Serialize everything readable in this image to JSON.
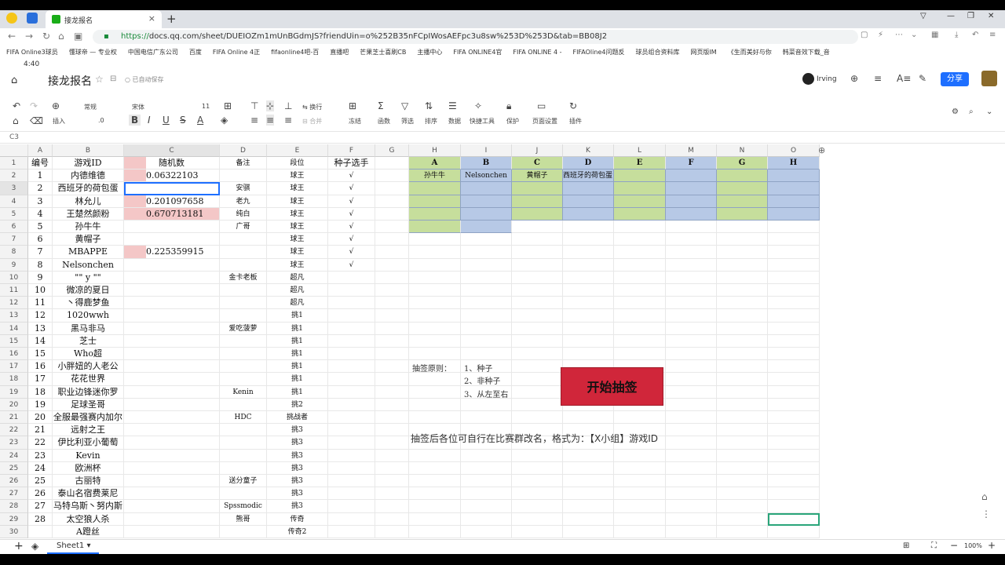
{
  "browser": {
    "tab_title": "接龙报名",
    "url_scheme": "https://",
    "url_rest": "docs.qq.com/sheet/DUEIOZm1mUnBGdmJS?friendUin=o%252B35nFCpIWosAEFpc3u8sw%253D%253D&tab=BB08J2",
    "bookmarks": [
      "FIFA Online3球员",
      "懂球帝 — 专业权",
      "中国电信广东公司",
      "百度",
      "FIFA Online 4正",
      "fifaonline4吧-百",
      "直播吧",
      "芒果芝士喜刷CB",
      "主播中心",
      "FIFA ONLINE4官",
      "FIFA ONLINE 4 -",
      "FIFAOline4问题反",
      "球员组合资料库",
      "网页版IM",
      "《生而美好与你",
      "韩菜音效下载_音"
    ]
  },
  "header": {
    "title": "接龙报名",
    "autosave": "已自动保存",
    "user": "Irving",
    "share": "分享"
  },
  "toolbar": {
    "font_style": "常规",
    "font": "宋体",
    "size": "11",
    "insert": "插入",
    "wrap": "换行",
    "merge": "合并",
    "freeze": "冻结",
    "func": "函数",
    "filter": "筛选",
    "sort": "排序",
    "data": "数据",
    "quick": "快捷工具",
    "protect": "保护",
    "page": "页面设置",
    "plugin": "插件"
  },
  "formula": {
    "cell_ref": "C3"
  },
  "columns": [
    "A",
    "B",
    "C",
    "D",
    "E",
    "F",
    "G",
    "H",
    "I",
    "J",
    "K",
    "L",
    "M",
    "N",
    "O"
  ],
  "rows_left": [
    [
      "编号",
      "游戏ID",
      "随机数",
      "备注",
      "段位",
      "种子选手"
    ],
    [
      "1",
      "内德维德",
      "0.06322103",
      "",
      "球王",
      "√"
    ],
    [
      "2",
      "西班牙的荷包蛋",
      "",
      "安骐",
      "球王",
      "√"
    ],
    [
      "3",
      "林允儿",
      "0.201097658",
      "老九",
      "球王",
      "√"
    ],
    [
      "4",
      "王楚然颜粉",
      "0.670713181",
      "纯白",
      "球王",
      "√"
    ],
    [
      "5",
      "孙牛牛",
      "",
      "广哥",
      "球王",
      "√"
    ],
    [
      "6",
      "黄帽子",
      "",
      "",
      "球王",
      "√"
    ],
    [
      "7",
      "MBAPPE",
      "0.225359915",
      "",
      "球王",
      "√"
    ],
    [
      "8",
      "Nelsonchen",
      "",
      "",
      "球王",
      "√"
    ],
    [
      "9",
      "\"\" y \"\"",
      "",
      "金卡老板",
      "超凡",
      ""
    ],
    [
      "10",
      "微凉的夏日",
      "",
      "",
      "超凡",
      ""
    ],
    [
      "11",
      "丶得鹿梦鱼",
      "",
      "",
      "超凡",
      ""
    ],
    [
      "12",
      "1020wwh",
      "",
      "",
      "挑1",
      ""
    ],
    [
      "13",
      "黑马非马",
      "",
      "爱吃菠萝",
      "挑1",
      ""
    ],
    [
      "14",
      "芝士",
      "",
      "",
      "挑1",
      ""
    ],
    [
      "15",
      "Who超",
      "",
      "",
      "挑1",
      ""
    ],
    [
      "16",
      "小胖妞的人老公",
      "",
      "",
      "挑1",
      ""
    ],
    [
      "17",
      "花花世界",
      "",
      "",
      "挑1",
      ""
    ],
    [
      "18",
      "职业边锋迷你罗",
      "",
      "Kenin",
      "挑1",
      ""
    ],
    [
      "19",
      "足球圣哥",
      "",
      "",
      "挑2",
      ""
    ],
    [
      "20",
      "全服最强赛内加尔",
      "",
      "HDC",
      "挑战者",
      ""
    ],
    [
      "21",
      "远射之王",
      "",
      "",
      "挑3",
      ""
    ],
    [
      "22",
      "伊比利亚小葡萄",
      "",
      "",
      "挑3",
      ""
    ],
    [
      "23",
      "Kevin",
      "",
      "",
      "挑3",
      ""
    ],
    [
      "24",
      "欧洲杯",
      "",
      "",
      "挑3",
      ""
    ],
    [
      "25",
      "古丽特",
      "",
      "送分童子",
      "挑3",
      ""
    ],
    [
      "26",
      "泰山名宿费莱尼",
      "",
      "",
      "挑3",
      ""
    ],
    [
      "27",
      "马特乌斯丶努内斯",
      "",
      "Spssmodic",
      "挑3",
      ""
    ],
    [
      "28",
      "太空狼人杀",
      "",
      "熊哥",
      "传奇",
      ""
    ],
    [
      "",
      "A蹬丝",
      "",
      "",
      "传奇2",
      ""
    ]
  ],
  "groups": {
    "headers": [
      "A",
      "B",
      "C",
      "D",
      "E",
      "F",
      "G",
      "H"
    ],
    "row1": [
      "孙牛牛",
      "Nelsonchen",
      "黄帽子",
      "西班牙的荷包蛋",
      "",
      "",
      "",
      ""
    ]
  },
  "rules": {
    "label": "抽签原则：",
    "items": [
      "1、种子",
      "2、非种子",
      "3、从左至右"
    ]
  },
  "draw_button": "开始抽签",
  "note": "抽签后各位可自行在比赛群改名，格式为：【X小组】游戏ID",
  "sheet": {
    "name": "Sheet1",
    "zoom": "100%"
  },
  "colors": {
    "green": "#c6de9c",
    "blue": "#b7c9e6",
    "pink": "#f4c7c7",
    "accent": "#1e6fff"
  }
}
